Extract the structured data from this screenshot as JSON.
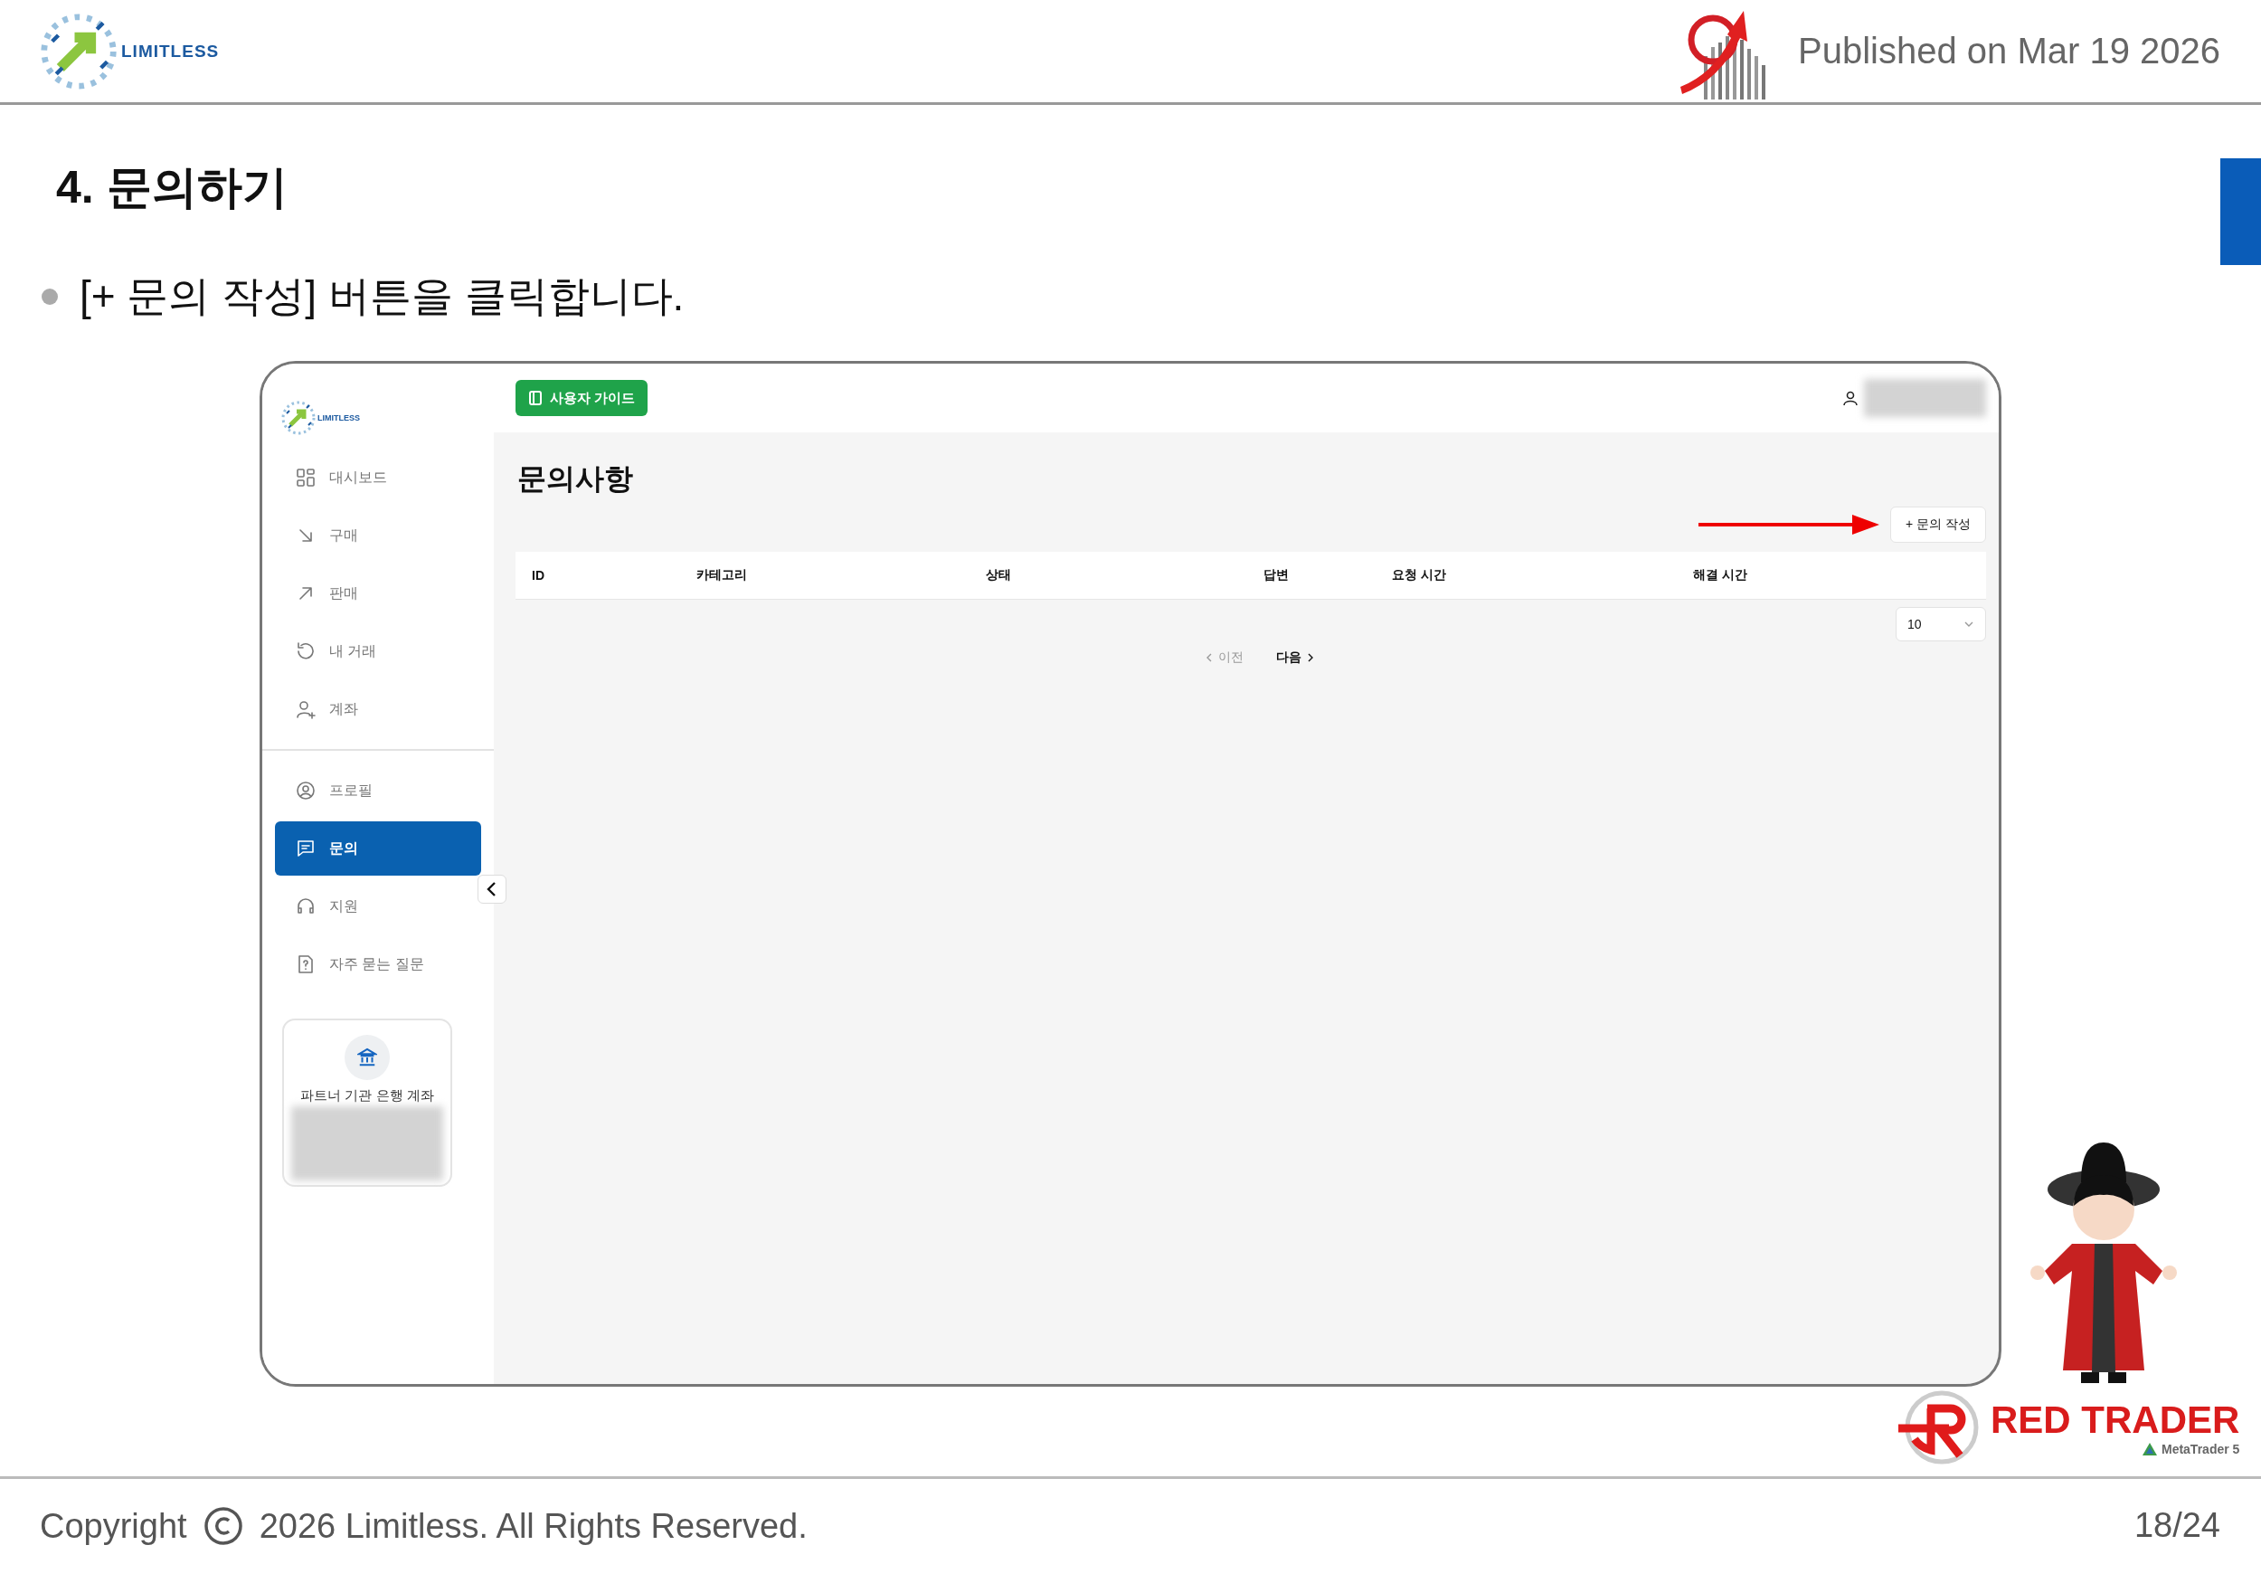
{
  "header": {
    "logo_text": "LIMITLESS",
    "published": "Published on Mar 19 2026"
  },
  "slide": {
    "title": "4. 문의하기",
    "bullets": [
      "[+ 문의 작성] 버튼을 클릭합니다."
    ]
  },
  "app": {
    "guide_button": "사용자 가이드",
    "sidebar": {
      "logo_text": "LIMITLESS",
      "groups": [
        [
          {
            "label": "대시보드",
            "selected": false
          },
          {
            "label": "구매",
            "selected": false
          },
          {
            "label": "판매",
            "selected": false
          },
          {
            "label": "내 거래",
            "selected": false
          },
          {
            "label": "계좌",
            "selected": false
          }
        ],
        [
          {
            "label": "프로필",
            "selected": false
          },
          {
            "label": "문의",
            "selected": true
          },
          {
            "label": "지원",
            "selected": false
          },
          {
            "label": "자주 묻는 질문",
            "selected": false
          }
        ]
      ],
      "card": {
        "title": "파트너 기관 은행 계좌"
      }
    },
    "page_title": "문의사항",
    "write_button": "+ 문의 작성",
    "table": {
      "columns": [
        "ID",
        "카테고리",
        "상태",
        "답변",
        "요청 시간",
        "해결 시간"
      ]
    },
    "page_size": "10",
    "pagination": [
      {
        "label": "이전",
        "disabled": true
      },
      {
        "label": "다음",
        "disabled": false
      }
    ]
  },
  "brand": {
    "name": "RED TRADER",
    "platform": "MetaTrader 5"
  },
  "footer": {
    "copyright": "Copyright",
    "rights": "2026 Limitless. All Rights Reserved.",
    "page": "18/24"
  }
}
